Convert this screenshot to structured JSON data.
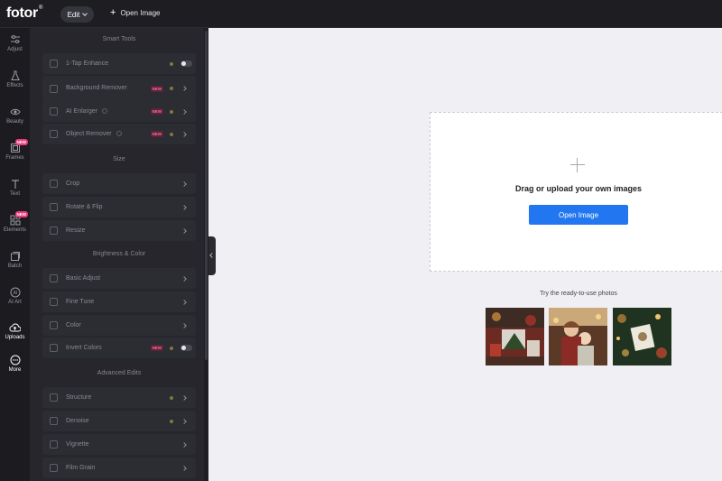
{
  "app": {
    "logo": "fotor",
    "logo_mark": "®"
  },
  "topbar": {
    "edit_label": "Edit",
    "open_image_label": "Open Image"
  },
  "rail": [
    {
      "label": "Adjust",
      "icon": "sliders-icon"
    },
    {
      "label": "Effects",
      "icon": "flask-icon"
    },
    {
      "label": "Beauty",
      "icon": "eye-icon"
    },
    {
      "label": "Frames",
      "icon": "frame-icon",
      "badge": "NEW"
    },
    {
      "label": "Text",
      "icon": "text-icon"
    },
    {
      "label": "Elements",
      "icon": "elements-icon",
      "badge": "NEW"
    },
    {
      "label": "Batch",
      "icon": "batch-icon"
    },
    {
      "label": "AI Art",
      "icon": "ai-art-icon"
    },
    {
      "label": "Uploads",
      "icon": "cloud-upload-icon"
    },
    {
      "label": "More",
      "icon": "more-icon"
    }
  ],
  "sections": {
    "smart_tools": "Smart Tools",
    "size": "Size",
    "brightness_color": "Brightness & Color",
    "advanced_edits": "Advanced Edits"
  },
  "tools": {
    "enhance": "1-Tap Enhance",
    "background_remover": "Background Remover",
    "ai_enlarger": "AI Enlarger",
    "object_remover": "Object Remover",
    "crop": "Crop",
    "rotate_flip": "Rotate & Flip",
    "resize": "Resize",
    "basic_adjust": "Basic Adjust",
    "fine_tune": "Fine Tune",
    "color": "Color",
    "invert_colors": "Invert Colors",
    "structure": "Structure",
    "denoise": "Denoise",
    "vignette": "Vignette",
    "film_grain": "Film Grain"
  },
  "new_badge": "NEW",
  "canvas": {
    "drop_text": "Drag or upload your own images",
    "open_button": "Open Image",
    "try_text": "Try the ready-to-use photos"
  },
  "colors": {
    "accent": "#2277f0",
    "new_badge": "#ea3a7a"
  }
}
